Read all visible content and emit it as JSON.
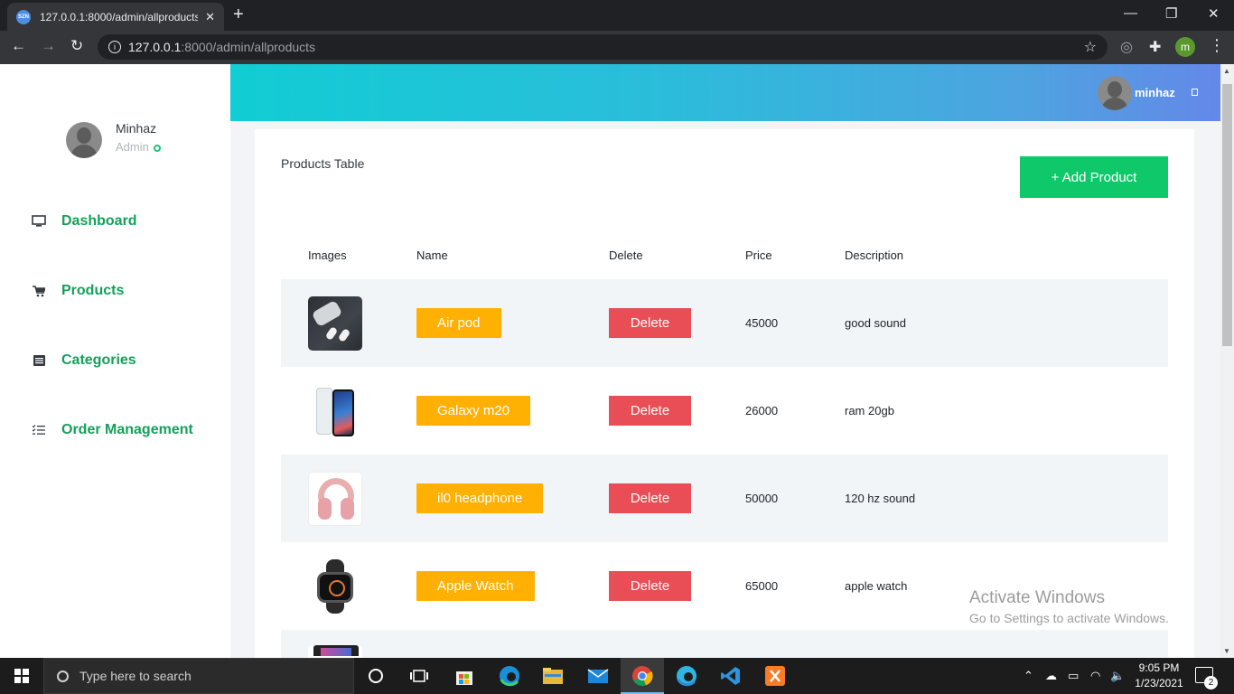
{
  "browser": {
    "tab_title": "127.0.0.1:8000/admin/allproducts",
    "tab_favicon_text": "SZN",
    "url_host": "127.0.0.1",
    "url_path": ":8000/admin/allproducts",
    "profile_initial": "m"
  },
  "sidebar": {
    "user_name": "Minhaz",
    "user_role": "Admin",
    "items": [
      {
        "label": "Dashboard",
        "icon": "monitor-icon"
      },
      {
        "label": "Products",
        "icon": "cart-icon"
      },
      {
        "label": "Categories",
        "icon": "list-box-icon"
      },
      {
        "label": "Order Management",
        "icon": "checklist-icon"
      }
    ]
  },
  "header": {
    "user_name": "minhaz"
  },
  "card": {
    "title": "Products Table",
    "add_button": "+ Add Product"
  },
  "table": {
    "columns": [
      "Images",
      "Name",
      "Delete",
      "Price",
      "Description"
    ],
    "delete_label": "Delete",
    "rows": [
      {
        "name": "Air pod",
        "price": "45000",
        "description": "good sound"
      },
      {
        "name": "Galaxy m20",
        "price": "26000",
        "description": "ram 20gb"
      },
      {
        "name": "il0 headphone",
        "price": "50000",
        "description": "120 hz sound"
      },
      {
        "name": "Apple Watch",
        "price": "65000",
        "description": "apple watch"
      }
    ]
  },
  "watermark": {
    "line1": "Activate Windows",
    "line2": "Go to Settings to activate Windows."
  },
  "taskbar": {
    "search_placeholder": "Type here to search",
    "time": "9:05 PM",
    "date": "1/23/2021",
    "notification_count": "2"
  },
  "colors": {
    "accent_green": "#15a05a",
    "add_button": "#0fc869",
    "name_badge": "#ffb002",
    "delete_button": "#e94d55",
    "header_gradient_start": "#11cdd4",
    "header_gradient_end": "#6488e8"
  }
}
